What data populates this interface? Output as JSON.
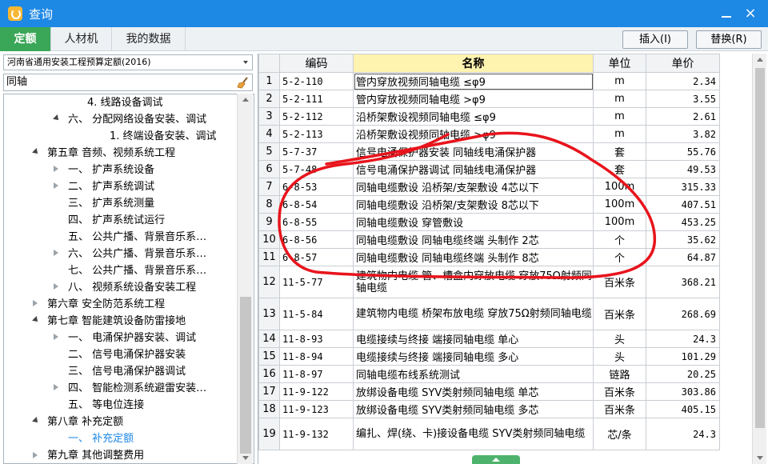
{
  "window": {
    "title": "查询",
    "close_glyph": "×"
  },
  "tabs": [
    {
      "label": "定额"
    },
    {
      "label": "人材机"
    },
    {
      "label": "我的数据"
    }
  ],
  "toolbar": {
    "insert_label": "插入(I)",
    "replace_label": "替换(R)"
  },
  "left": {
    "library_select": "河南省通用安装工程预算定额(2016)",
    "search_value": "同轴",
    "tree": [
      {
        "label": "4. 线路设备调试"
      },
      {
        "label": "六、 分配网络设备安装、调试"
      },
      {
        "label": "1. 终端设备安装、调试"
      },
      {
        "label": "第五章 音频、视频系统工程"
      },
      {
        "label": "一、 扩声系统设备"
      },
      {
        "label": "二、 扩声系统调试"
      },
      {
        "label": "三、 扩声系统测量"
      },
      {
        "label": "四、 扩声系统试运行"
      },
      {
        "label": "五、 公共广播、背景音乐系…"
      },
      {
        "label": "六、 公共广播、背景音乐系…"
      },
      {
        "label": "七、 公共广播、背景音乐系…"
      },
      {
        "label": "八、 视频系统设备安装工程"
      },
      {
        "label": "第六章 安全防范系统工程"
      },
      {
        "label": "第七章 智能建筑设备防雷接地"
      },
      {
        "label": "一、 电涌保护器安装、调试"
      },
      {
        "label": "二、 信号电涌保护器安装"
      },
      {
        "label": "三、 信号电涌保护器调试"
      },
      {
        "label": "四、 智能检测系统避雷安装…"
      },
      {
        "label": "五、 等电位连接"
      },
      {
        "label": "第八章 补充定额"
      },
      {
        "label": "一、 补充定额"
      },
      {
        "label": "第九章 其他调整费用"
      }
    ]
  },
  "grid": {
    "headers": {
      "code": "编码",
      "name": "名称",
      "unit": "单位",
      "price": "单价"
    },
    "rows": [
      {
        "idx": "1",
        "code": "5-2-110",
        "name": "管内穿放视频同轴电缆 ≤φ9",
        "unit": "m",
        "price": "2.34"
      },
      {
        "idx": "2",
        "code": "5-2-111",
        "name": "管内穿放视频同轴电缆 >φ9",
        "unit": "m",
        "price": "3.55"
      },
      {
        "idx": "3",
        "code": "5-2-112",
        "name": "沿桥架敷设视频同轴电缆 ≤φ9",
        "unit": "m",
        "price": "2.61"
      },
      {
        "idx": "4",
        "code": "5-2-113",
        "name": "沿桥架敷设视频同轴电缆 >φ9",
        "unit": "m",
        "price": "3.82"
      },
      {
        "idx": "5",
        "code": "5-7-37",
        "name": "信号电涌保护器安装 同轴线电涌保护器",
        "unit": "套",
        "price": "55.76"
      },
      {
        "idx": "6",
        "code": "5-7-48",
        "name": "信号电涌保护器调试 同轴线电涌保护器",
        "unit": "套",
        "price": "49.53"
      },
      {
        "idx": "7",
        "code": "6-8-53",
        "name": "同轴电缆敷设 沿桥架/支架敷设 4芯以下",
        "unit": "100m",
        "price": "315.33"
      },
      {
        "idx": "8",
        "code": "6-8-54",
        "name": "同轴电缆敷设 沿桥架/支架敷设 8芯以下",
        "unit": "100m",
        "price": "407.51"
      },
      {
        "idx": "9",
        "code": "6-8-55",
        "name": "同轴电缆敷设 穿管敷设",
        "unit": "100m",
        "price": "453.25"
      },
      {
        "idx": "10",
        "code": "6-8-56",
        "name": "同轴电缆敷设 同轴电缆终端 头制作 2芯",
        "unit": "个",
        "price": "35.62"
      },
      {
        "idx": "11",
        "code": "6-8-57",
        "name": "同轴电缆敷设 同轴电缆终端 头制作 8芯",
        "unit": "个",
        "price": "64.87"
      },
      {
        "idx": "12",
        "code": "11-5-77",
        "name": "建筑物内电缆 管、槽盒内穿放电缆 穿放75Ω射频同轴电缆",
        "unit": "百米条",
        "price": "368.21"
      },
      {
        "idx": "13",
        "code": "11-5-84",
        "name": "建筑物内电缆 桥架布放电缆 穿放75Ω射频同轴电缆",
        "unit": "百米条",
        "price": "268.69"
      },
      {
        "idx": "14",
        "code": "11-8-93",
        "name": "电缆接续与终接 端接同轴电缆 单心",
        "unit": "头",
        "price": "24.3"
      },
      {
        "idx": "15",
        "code": "11-8-94",
        "name": "电缆接续与终接 端接同轴电缆 多心",
        "unit": "头",
        "price": "101.29"
      },
      {
        "idx": "16",
        "code": "11-8-97",
        "name": "同轴电缆布线系统测试",
        "unit": "链路",
        "price": "20.25"
      },
      {
        "idx": "17",
        "code": "11-9-122",
        "name": "放绑设备电缆 SYV类射频同轴电缆 单芯",
        "unit": "百米条",
        "price": "303.86"
      },
      {
        "idx": "18",
        "code": "11-9-123",
        "name": "放绑设备电缆 SYV类射频同轴电缆 多芯",
        "unit": "百米条",
        "price": "405.15"
      },
      {
        "idx": "19",
        "code": "11-9-132",
        "name": "编扎、焊(绕、卡)接设备电缆 SYV类射频同轴电缆",
        "unit": "芯/条",
        "price": "24.3"
      }
    ]
  },
  "colors": {
    "titlebar": "#1e88e5",
    "active_tab": "#3aa657",
    "annotation": "#e8141c",
    "header_highlight": "#fff3b0"
  }
}
